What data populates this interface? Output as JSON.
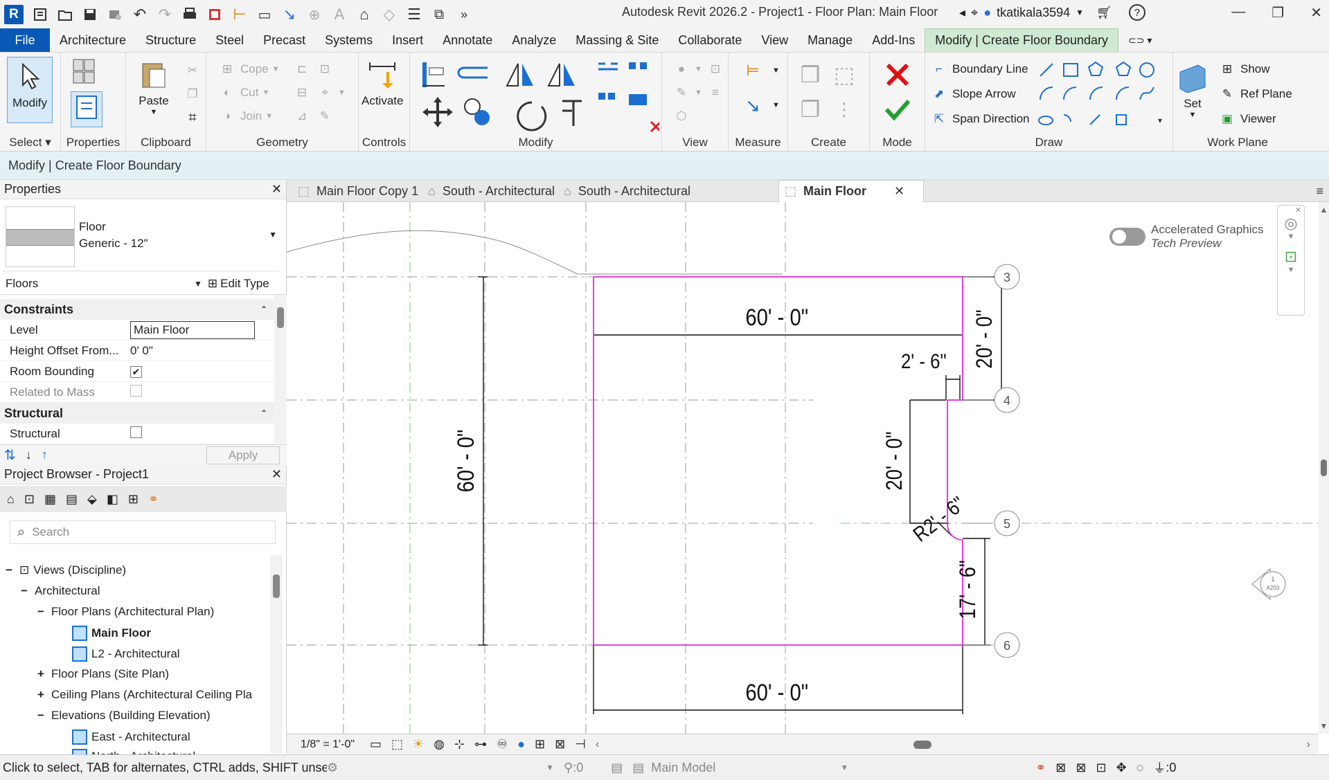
{
  "titlebar": {
    "title": "Autodesk Revit 2026.2 - Project1 - Floor Plan: Main Floor",
    "username": "tkatikala3594",
    "app_letter": "R"
  },
  "ribbon_tabs": [
    "File",
    "Architecture",
    "Structure",
    "Steel",
    "Precast",
    "Systems",
    "Insert",
    "Annotate",
    "Analyze",
    "Massing & Site",
    "Collaborate",
    "View",
    "Manage",
    "Add-Ins",
    "Modify | Create Floor Boundary"
  ],
  "ribbon": {
    "select": {
      "modify": "Modify",
      "label": "Select"
    },
    "properties": {
      "label": "Properties"
    },
    "clipboard": {
      "paste": "Paste",
      "label": "Clipboard"
    },
    "geometry": {
      "cope": "Cope",
      "cut": "Cut",
      "join": "Join",
      "label": "Geometry"
    },
    "controls": {
      "activate": "Activate",
      "label": "Controls"
    },
    "modify": {
      "label": "Modify"
    },
    "view": {
      "label": "View"
    },
    "measure": {
      "label": "Measure"
    },
    "create": {
      "label": "Create"
    },
    "mode": {
      "label": "Mode"
    },
    "draw": {
      "boundary_line": "Boundary Line",
      "slope_arrow": "Slope Arrow",
      "span_direction": "Span Direction",
      "label": "Draw"
    },
    "workplane": {
      "show": "Show",
      "ref_plane": "Ref  Plane",
      "viewer": "Viewer",
      "set": "Set",
      "label": "Work Plane"
    }
  },
  "context_bar": "Modify | Create Floor Boundary",
  "properties": {
    "title": "Properties",
    "type_family": "Floor",
    "type_name": "Generic - 12\"",
    "filter": "Floors",
    "edit_type": "Edit Type",
    "cat_constraints": "Constraints",
    "level_label": "Level",
    "level_value": "Main Floor",
    "offset_label": "Height Offset From...",
    "offset_value": "0'  0\"",
    "room_label": "Room Bounding",
    "mass_label": "Related to Mass",
    "cat_structural": "Structural",
    "structural_label": "Structural",
    "apply": "Apply"
  },
  "browser": {
    "title": "Project Browser - Project1",
    "search_placeholder": "Search",
    "nodes": [
      "Views (Discipline)",
      "Architectural",
      "Floor Plans (Architectural Plan)",
      "Main Floor",
      "L2 - Architectural",
      "Floor Plans (Site Plan)",
      "Ceiling Plans (Architectural Ceiling Pla",
      "Elevations (Building Elevation)",
      "East - Architectural",
      "North - Architectural"
    ]
  },
  "view_tabs": [
    "Main Floor Copy 1",
    "South - Architectural",
    "South - Architectural",
    "Main Floor"
  ],
  "canvas": {
    "accel_title": "Accelerated Graphics",
    "accel_sub": "Tech Preview",
    "dims": {
      "top": "60' - 0\"",
      "bottom": "60' - 0\"",
      "left": "60' - 0\"",
      "right_top": "20' - 0\"",
      "notch": "2' - 6\"",
      "mid": "20' - 0\"",
      "radius": "R2' - 6\"",
      "right_low": "17' - 6\""
    },
    "grids": [
      "3",
      "4",
      "5",
      "6"
    ],
    "elev_tag": "A203",
    "elev_num": "1"
  },
  "viewctl": {
    "scale": "1/8\" = 1'-0\""
  },
  "status": {
    "hint": "Click to select, TAB for alternates, CTRL adds, SHIFT unselect",
    "count": ":0",
    "model": "Main Model",
    "filter": ":0"
  },
  "colors": {
    "accent": "#0a58b5",
    "sketch": "#e040e0",
    "context": "#cfe9d2"
  }
}
